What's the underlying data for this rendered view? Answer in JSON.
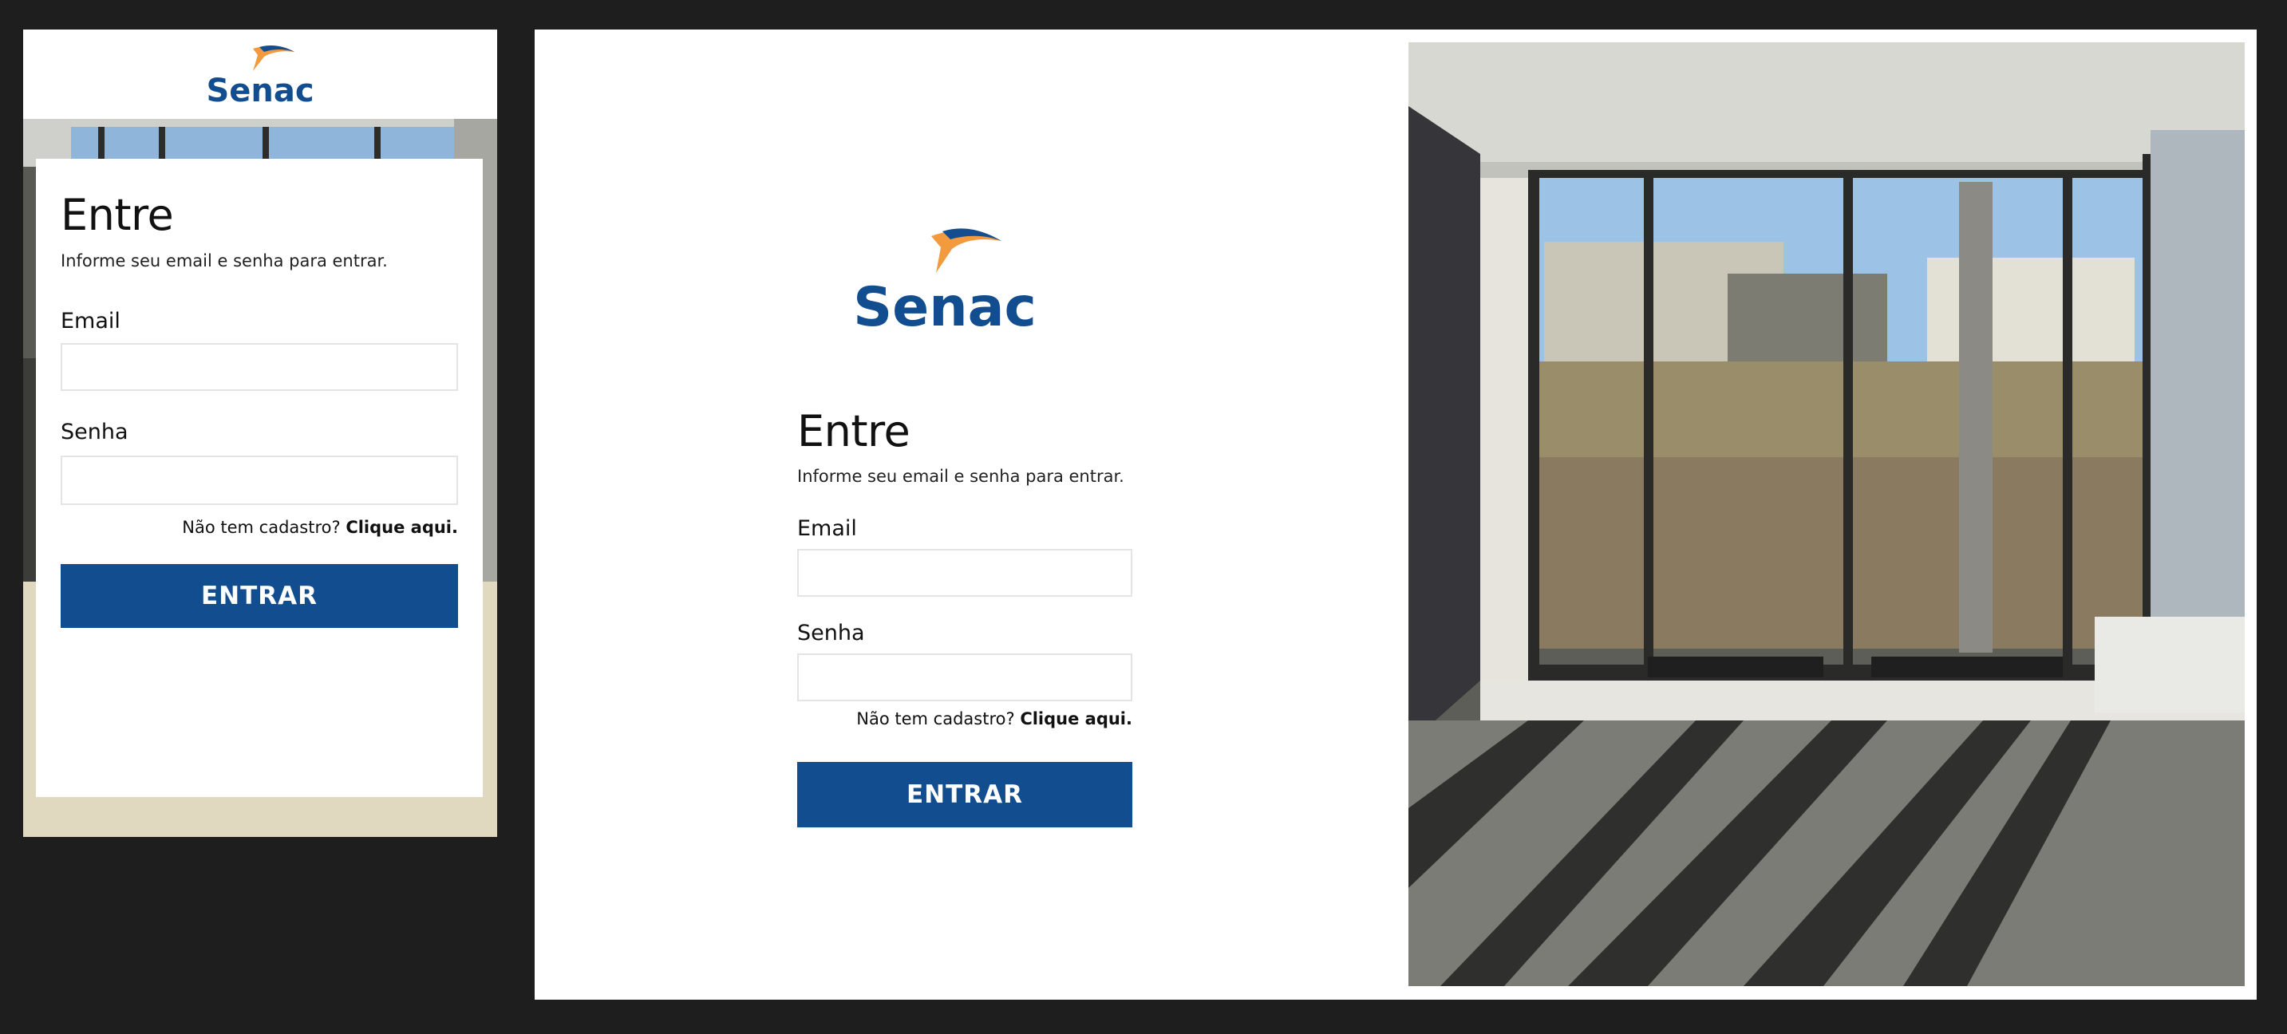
{
  "colors": {
    "brand_blue": "#124e8f",
    "brand_orange": "#f29a3e",
    "page_background": "#1e1e1e"
  },
  "brand": {
    "logo_text": "Senac"
  },
  "mobile": {
    "title": "Entre",
    "subtitle": "Informe seu email e senha para entrar.",
    "email_label": "Email",
    "email_value": "",
    "password_label": "Senha",
    "password_value": "",
    "signup_prompt": "Não tem cadastro?",
    "signup_link": "Clique aqui.",
    "submit_label": "ENTRAR"
  },
  "desktop": {
    "title": "Entre",
    "subtitle": "Informe seu email e senha para entrar.",
    "email_label": "Email",
    "email_value": "",
    "password_label": "Senha",
    "password_value": "",
    "signup_prompt": "Não tem cadastro?",
    "signup_link": "Clique aqui.",
    "submit_label": "ENTRAR"
  },
  "photo": {
    "subject": "office-interior-window-terrace"
  }
}
